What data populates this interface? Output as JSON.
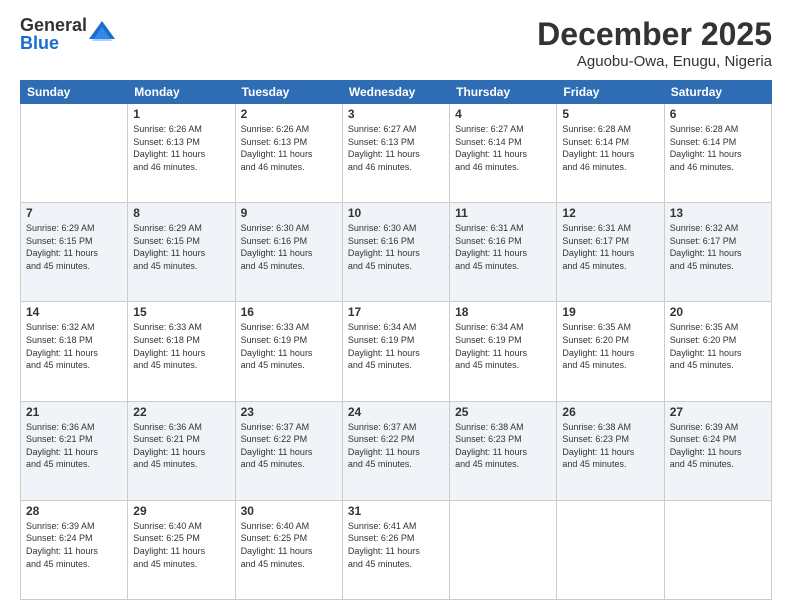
{
  "logo": {
    "general": "General",
    "blue": "Blue"
  },
  "title": "December 2025",
  "location": "Aguobu-Owa, Enugu, Nigeria",
  "weekdays": [
    "Sunday",
    "Monday",
    "Tuesday",
    "Wednesday",
    "Thursday",
    "Friday",
    "Saturday"
  ],
  "weeks": [
    [
      {
        "day": "",
        "info": ""
      },
      {
        "day": "1",
        "info": "Sunrise: 6:26 AM\nSunset: 6:13 PM\nDaylight: 11 hours\nand 46 minutes."
      },
      {
        "day": "2",
        "info": "Sunrise: 6:26 AM\nSunset: 6:13 PM\nDaylight: 11 hours\nand 46 minutes."
      },
      {
        "day": "3",
        "info": "Sunrise: 6:27 AM\nSunset: 6:13 PM\nDaylight: 11 hours\nand 46 minutes."
      },
      {
        "day": "4",
        "info": "Sunrise: 6:27 AM\nSunset: 6:14 PM\nDaylight: 11 hours\nand 46 minutes."
      },
      {
        "day": "5",
        "info": "Sunrise: 6:28 AM\nSunset: 6:14 PM\nDaylight: 11 hours\nand 46 minutes."
      },
      {
        "day": "6",
        "info": "Sunrise: 6:28 AM\nSunset: 6:14 PM\nDaylight: 11 hours\nand 46 minutes."
      }
    ],
    [
      {
        "day": "7",
        "info": "Sunrise: 6:29 AM\nSunset: 6:15 PM\nDaylight: 11 hours\nand 45 minutes."
      },
      {
        "day": "8",
        "info": "Sunrise: 6:29 AM\nSunset: 6:15 PM\nDaylight: 11 hours\nand 45 minutes."
      },
      {
        "day": "9",
        "info": "Sunrise: 6:30 AM\nSunset: 6:16 PM\nDaylight: 11 hours\nand 45 minutes."
      },
      {
        "day": "10",
        "info": "Sunrise: 6:30 AM\nSunset: 6:16 PM\nDaylight: 11 hours\nand 45 minutes."
      },
      {
        "day": "11",
        "info": "Sunrise: 6:31 AM\nSunset: 6:16 PM\nDaylight: 11 hours\nand 45 minutes."
      },
      {
        "day": "12",
        "info": "Sunrise: 6:31 AM\nSunset: 6:17 PM\nDaylight: 11 hours\nand 45 minutes."
      },
      {
        "day": "13",
        "info": "Sunrise: 6:32 AM\nSunset: 6:17 PM\nDaylight: 11 hours\nand 45 minutes."
      }
    ],
    [
      {
        "day": "14",
        "info": "Sunrise: 6:32 AM\nSunset: 6:18 PM\nDaylight: 11 hours\nand 45 minutes."
      },
      {
        "day": "15",
        "info": "Sunrise: 6:33 AM\nSunset: 6:18 PM\nDaylight: 11 hours\nand 45 minutes."
      },
      {
        "day": "16",
        "info": "Sunrise: 6:33 AM\nSunset: 6:19 PM\nDaylight: 11 hours\nand 45 minutes."
      },
      {
        "day": "17",
        "info": "Sunrise: 6:34 AM\nSunset: 6:19 PM\nDaylight: 11 hours\nand 45 minutes."
      },
      {
        "day": "18",
        "info": "Sunrise: 6:34 AM\nSunset: 6:19 PM\nDaylight: 11 hours\nand 45 minutes."
      },
      {
        "day": "19",
        "info": "Sunrise: 6:35 AM\nSunset: 6:20 PM\nDaylight: 11 hours\nand 45 minutes."
      },
      {
        "day": "20",
        "info": "Sunrise: 6:35 AM\nSunset: 6:20 PM\nDaylight: 11 hours\nand 45 minutes."
      }
    ],
    [
      {
        "day": "21",
        "info": "Sunrise: 6:36 AM\nSunset: 6:21 PM\nDaylight: 11 hours\nand 45 minutes."
      },
      {
        "day": "22",
        "info": "Sunrise: 6:36 AM\nSunset: 6:21 PM\nDaylight: 11 hours\nand 45 minutes."
      },
      {
        "day": "23",
        "info": "Sunrise: 6:37 AM\nSunset: 6:22 PM\nDaylight: 11 hours\nand 45 minutes."
      },
      {
        "day": "24",
        "info": "Sunrise: 6:37 AM\nSunset: 6:22 PM\nDaylight: 11 hours\nand 45 minutes."
      },
      {
        "day": "25",
        "info": "Sunrise: 6:38 AM\nSunset: 6:23 PM\nDaylight: 11 hours\nand 45 minutes."
      },
      {
        "day": "26",
        "info": "Sunrise: 6:38 AM\nSunset: 6:23 PM\nDaylight: 11 hours\nand 45 minutes."
      },
      {
        "day": "27",
        "info": "Sunrise: 6:39 AM\nSunset: 6:24 PM\nDaylight: 11 hours\nand 45 minutes."
      }
    ],
    [
      {
        "day": "28",
        "info": "Sunrise: 6:39 AM\nSunset: 6:24 PM\nDaylight: 11 hours\nand 45 minutes."
      },
      {
        "day": "29",
        "info": "Sunrise: 6:40 AM\nSunset: 6:25 PM\nDaylight: 11 hours\nand 45 minutes."
      },
      {
        "day": "30",
        "info": "Sunrise: 6:40 AM\nSunset: 6:25 PM\nDaylight: 11 hours\nand 45 minutes."
      },
      {
        "day": "31",
        "info": "Sunrise: 6:41 AM\nSunset: 6:26 PM\nDaylight: 11 hours\nand 45 minutes."
      },
      {
        "day": "",
        "info": ""
      },
      {
        "day": "",
        "info": ""
      },
      {
        "day": "",
        "info": ""
      }
    ]
  ]
}
